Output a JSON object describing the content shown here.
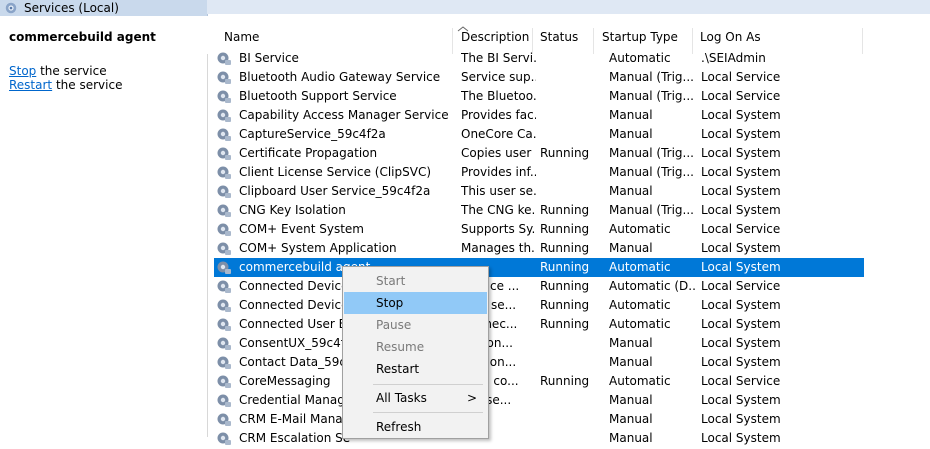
{
  "window": {
    "title": "Services (Local)"
  },
  "left_pane": {
    "service_title": "commercebuild agent",
    "actions": [
      {
        "link": "Stop",
        "rest": " the service"
      },
      {
        "link": "Restart",
        "rest": " the service"
      }
    ]
  },
  "table": {
    "columns": [
      "Name",
      "Description",
      "Status",
      "Startup Type",
      "Log On As"
    ],
    "rows": [
      {
        "name": "BI Service",
        "description": "The BI Servi...",
        "status": "",
        "startup": "Automatic",
        "logon": ".\\SEIAdmin"
      },
      {
        "name": "Bluetooth Audio Gateway Service",
        "description": "Service sup...",
        "status": "",
        "startup": "Manual (Trig...",
        "logon": "Local Service"
      },
      {
        "name": "Bluetooth Support Service",
        "description": "The Bluetoo...",
        "status": "",
        "startup": "Manual (Trig...",
        "logon": "Local Service"
      },
      {
        "name": "Capability Access Manager Service",
        "description": "Provides fac...",
        "status": "",
        "startup": "Manual",
        "logon": "Local System"
      },
      {
        "name": "CaptureService_59c4f2a",
        "description": "OneCore Ca...",
        "status": "",
        "startup": "Manual",
        "logon": "Local System"
      },
      {
        "name": "Certificate Propagation",
        "description": "Copies user ...",
        "status": "Running",
        "startup": "Manual (Trig...",
        "logon": "Local System"
      },
      {
        "name": "Client License Service (ClipSVC)",
        "description": "Provides inf...",
        "status": "",
        "startup": "Manual (Trig...",
        "logon": "Local System"
      },
      {
        "name": "Clipboard User Service_59c4f2a",
        "description": "This user se...",
        "status": "",
        "startup": "Manual",
        "logon": "Local System"
      },
      {
        "name": "CNG Key Isolation",
        "description": "The CNG ke...",
        "status": "Running",
        "startup": "Manual (Trig...",
        "logon": "Local System"
      },
      {
        "name": "COM+ Event System",
        "description": "Supports Sy...",
        "status": "Running",
        "startup": "Automatic",
        "logon": "Local Service"
      },
      {
        "name": "COM+ System Application",
        "description": "Manages th...",
        "status": "Running",
        "startup": "Manual",
        "logon": "Local System"
      },
      {
        "name": "commercebuild agent",
        "description": "",
        "status": "Running",
        "startup": "Automatic",
        "logon": "Local System"
      },
      {
        "name": "Connected Devices",
        "description": "service ...",
        "status": "Running",
        "startup": "Automatic (D...",
        "logon": "Local Service"
      },
      {
        "name": "Connected Devices",
        "description": "user se...",
        "status": "Running",
        "startup": "Automatic",
        "logon": "Local System"
      },
      {
        "name": "Connected User Exp",
        "description": "Connec...",
        "status": "Running",
        "startup": "Automatic",
        "logon": "Local System"
      },
      {
        "name": "ConsentUX_59c4f2a",
        "description": "vs Con...",
        "status": "",
        "startup": "Manual",
        "logon": "Local System"
      },
      {
        "name": "Contact Data_59c4f",
        "description": "tes con...",
        "status": "",
        "startup": "Manual",
        "logon": "Local System"
      },
      {
        "name": "CoreMessaging",
        "description": "ages co...",
        "status": "Running",
        "startup": "Automatic",
        "logon": "Local Service"
      },
      {
        "name": "Credential Manage",
        "description": "des se...",
        "status": "",
        "startup": "Manual",
        "logon": "Local System"
      },
      {
        "name": "CRM E-Mail Manag",
        "description": "",
        "status": "",
        "startup": "Manual",
        "logon": "Local System"
      },
      {
        "name": "CRM Escalation Se",
        "description": "",
        "status": "",
        "startup": "Manual",
        "logon": "Local System"
      }
    ]
  },
  "context_menu": {
    "items": [
      {
        "label": "Start",
        "disabled": true
      },
      {
        "label": "Stop",
        "disabled": false,
        "hover": true
      },
      {
        "label": "Pause",
        "disabled": true
      },
      {
        "label": "Resume",
        "disabled": true
      },
      {
        "label": "Restart",
        "disabled": false
      },
      {
        "label": "All Tasks",
        "disabled": false,
        "submenu": true,
        "arrow": ">"
      },
      {
        "label": "Refresh",
        "disabled": false
      }
    ]
  },
  "colors": {
    "selection": "#0078d7",
    "menu_hover": "#91c9f7",
    "link": "#0066cc"
  }
}
